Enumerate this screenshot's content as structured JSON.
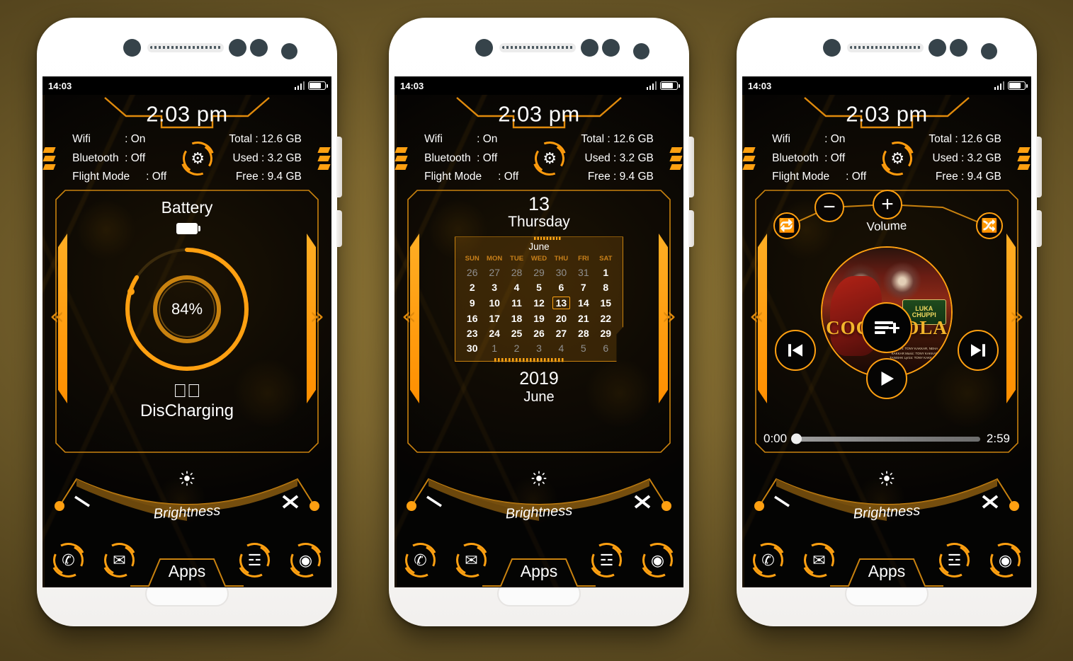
{
  "meta": {
    "accent": "#ffa011",
    "accent_dark": "#c9820f",
    "screen_bg": "#050403",
    "page_bg": "#7d672f"
  },
  "status_bar": {
    "time": "14:03",
    "signal_icon": "signal-bars-icon",
    "battery_icon": "battery-icon"
  },
  "clock": {
    "time": "2:03 pm"
  },
  "info": {
    "left": [
      {
        "label": "Wifi",
        "sep": ":",
        "value": "On"
      },
      {
        "label": "Bluetooth",
        "sep": ":",
        "value": "Off"
      },
      {
        "label": "Flight Mode",
        "sep": ":",
        "value": "Off"
      }
    ],
    "right": [
      {
        "text": "Total : 12.6 GB"
      },
      {
        "text": "Used : 3.2 GB"
      },
      {
        "text": "Free : 9.4 GB"
      }
    ],
    "settings_icon": "gear-icon"
  },
  "nav": {
    "prev": "«",
    "next": "»"
  },
  "battery_panel": {
    "title": "Battery",
    "icon": "battery-icon",
    "percent_label": "84%",
    "percent_value": 84,
    "status": "DisCharging",
    "status_icon": "plug-disconnected-icon"
  },
  "calendar_panel": {
    "day_number": "13",
    "day_name": "Thursday",
    "month_header": "June",
    "weekdays": [
      "SUN",
      "MON",
      "TUE",
      "WED",
      "THU",
      "FRI",
      "SAT"
    ],
    "weeks": [
      [
        {
          "d": "26",
          "dim": true
        },
        {
          "d": "27",
          "dim": true
        },
        {
          "d": "28",
          "dim": true
        },
        {
          "d": "29",
          "dim": true
        },
        {
          "d": "30",
          "dim": true
        },
        {
          "d": "31",
          "dim": true
        },
        {
          "d": "1"
        }
      ],
      [
        {
          "d": "2"
        },
        {
          "d": "3"
        },
        {
          "d": "4"
        },
        {
          "d": "5"
        },
        {
          "d": "6"
        },
        {
          "d": "7"
        },
        {
          "d": "8"
        }
      ],
      [
        {
          "d": "9"
        },
        {
          "d": "10"
        },
        {
          "d": "11"
        },
        {
          "d": "12"
        },
        {
          "d": "13",
          "today": true
        },
        {
          "d": "14"
        },
        {
          "d": "15"
        }
      ],
      [
        {
          "d": "16"
        },
        {
          "d": "17"
        },
        {
          "d": "18"
        },
        {
          "d": "19"
        },
        {
          "d": "20"
        },
        {
          "d": "21"
        },
        {
          "d": "22"
        }
      ],
      [
        {
          "d": "23"
        },
        {
          "d": "24"
        },
        {
          "d": "25"
        },
        {
          "d": "26"
        },
        {
          "d": "27"
        },
        {
          "d": "28"
        },
        {
          "d": "29"
        }
      ],
      [
        {
          "d": "30"
        },
        {
          "d": "1",
          "dim": true
        },
        {
          "d": "2",
          "dim": true
        },
        {
          "d": "3",
          "dim": true
        },
        {
          "d": "4",
          "dim": true
        },
        {
          "d": "5",
          "dim": true
        },
        {
          "d": "6",
          "dim": true
        }
      ]
    ],
    "year": "2019",
    "month_footer": "June"
  },
  "music_panel": {
    "volume_label": "Volume",
    "volume_down_icon": "minus-icon",
    "volume_up_icon": "plus-icon",
    "repeat_icon": "repeat-icon",
    "shuffle_icon": "shuffle-icon",
    "playlist_icon": "playlist-add-icon",
    "previous_icon": "skip-previous-icon",
    "next_icon": "skip-next-icon",
    "play_icon": "play-icon",
    "album_title": "COCA COLA",
    "album_badge_line1": "LUKA",
    "album_badge_line2": "CHUPPI",
    "album_credits": "Singers: TONY KAKKAR, NEHA KAKKAR\nMusic: TONY KAKKAR, TANISHK\nLyrics: TONY KAKKAR, S",
    "time_current": "0:00",
    "time_total": "2:59",
    "progress_percent": 0
  },
  "brightness": {
    "label": "Brightness",
    "sun_icon": "brightness-sun-icon",
    "min_icon": "brightness-low-icon",
    "max_icon": "brightness-high-icon",
    "value_percent": 52
  },
  "dock": {
    "apps_label": "Apps",
    "items": [
      {
        "name": "phone",
        "icon": "phone-icon",
        "glyph": "✆"
      },
      {
        "name": "mail",
        "icon": "mail-icon",
        "glyph": "✉"
      },
      {
        "name": "messages",
        "icon": "message-icon",
        "glyph": "☲"
      },
      {
        "name": "browser",
        "icon": "chrome-icon",
        "glyph": "◉"
      }
    ]
  },
  "phones": [
    {
      "id": "phone-1",
      "panel": "battery"
    },
    {
      "id": "phone-2",
      "panel": "calendar"
    },
    {
      "id": "phone-3",
      "panel": "music"
    }
  ]
}
